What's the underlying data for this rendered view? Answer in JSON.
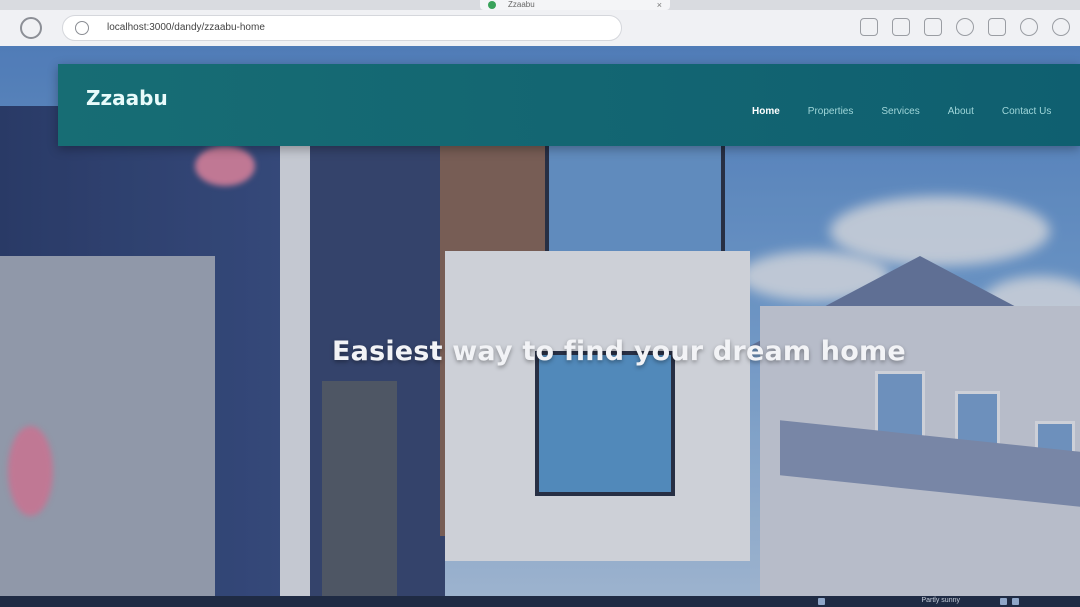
{
  "browser": {
    "tab_title": "Zzaabu",
    "tab_close": "×",
    "url": "localhost:3000/dandy/zzaabu-home",
    "icons": [
      "back-icon",
      "info-icon",
      "star-icon",
      "collections-icon",
      "profile-icon",
      "extensions-icon",
      "settings-icon"
    ]
  },
  "site": {
    "brand": "Zzaabu",
    "nav": [
      {
        "label": "Home",
        "active": true
      },
      {
        "label": "Properties",
        "active": false
      },
      {
        "label": "Services",
        "active": false
      },
      {
        "label": "About",
        "active": false
      },
      {
        "label": "Contact Us",
        "active": false
      }
    ],
    "hero_title": "Easiest way to find your dream home"
  },
  "taskbar": {
    "weather": "Partly sunny"
  },
  "colors": {
    "navbar": "#176d74",
    "nav_link": "#9fd6d9",
    "nav_active": "#ffffff"
  }
}
